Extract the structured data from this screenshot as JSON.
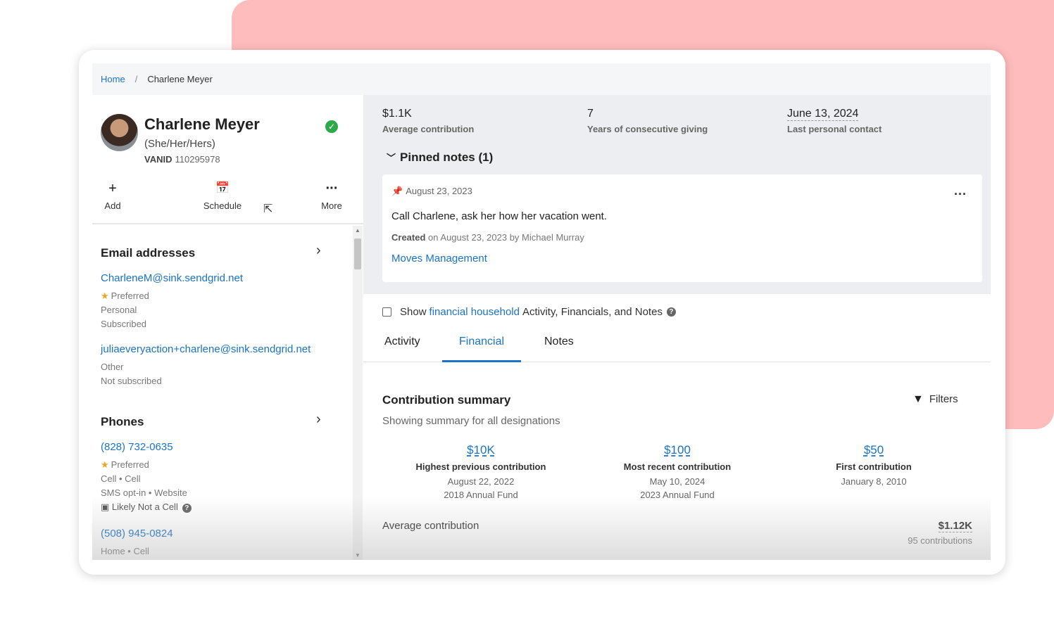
{
  "breadcrumb": {
    "home": "Home",
    "separator": "/",
    "current": "Charlene Meyer"
  },
  "profile": {
    "name": "Charlene Meyer",
    "pronouns": "(She/Her/Hers)",
    "vanid_label": "VANID",
    "vanid": "110295978",
    "verified_icon": "check-circle-icon"
  },
  "actions": [
    {
      "label": "Add",
      "icon": "+"
    },
    {
      "label": "Schedule",
      "icon": "📅"
    },
    {
      "label": "More",
      "icon": "···"
    }
  ],
  "emails": {
    "title": "Email addresses",
    "items": [
      {
        "address": "CharleneM@sink.sendgrid.net",
        "preferred": "Preferred",
        "type": "Personal",
        "status": "Subscribed"
      },
      {
        "address": "juliaeveryaction+charlene@sink.sendgrid.net",
        "type": "Other",
        "status": "Not subscribed"
      }
    ]
  },
  "phones": {
    "title": "Phones",
    "items": [
      {
        "number": "(828) 732-0635",
        "preferred": "Preferred",
        "type": "Cell • Cell",
        "opt": "SMS opt-in • Website",
        "warning": "Likely Not a Cell"
      },
      {
        "number": "(508) 945-0824",
        "type": "Home • Cell"
      }
    ]
  },
  "stats": [
    {
      "value": "$1.1K",
      "label": "Average contribution"
    },
    {
      "value": "7",
      "label": "Years of consecutive giving"
    },
    {
      "value": "June 13, 2024",
      "label": "Last personal contact"
    }
  ],
  "pinned": {
    "title": "Pinned notes (1)",
    "note": {
      "date": "August 23, 2023",
      "text": "Call Charlene, ask her how her vacation went.",
      "created_label": "Created",
      "created_rest": "on August 23, 2023 by Michael Murray",
      "tag": "Moves Management"
    }
  },
  "household": {
    "pre": "Show",
    "link": "financial household",
    "post": "Activity, Financials, and Notes"
  },
  "tabs": [
    {
      "label": "Activity",
      "active": false
    },
    {
      "label": "Financial",
      "active": true
    },
    {
      "label": "Notes",
      "active": false
    }
  ],
  "contribution": {
    "title": "Contribution summary",
    "subtitle": "Showing summary for all designations",
    "filters": "Filters",
    "columns": [
      {
        "value": "$10K",
        "label": "Highest previous contribution",
        "date": "August 22, 2022",
        "fund": "2018 Annual Fund"
      },
      {
        "value": "$100",
        "label": "Most recent contribution",
        "date": "May 10, 2024",
        "fund": "2023 Annual Fund"
      },
      {
        "value": "$50",
        "label": "First contribution",
        "date": "January 8, 2010",
        "fund": ""
      }
    ],
    "average_label": "Average contribution",
    "average_value": "$1.12K",
    "average_count": "95 contributions"
  },
  "colors": {
    "accent": "#1a73c7",
    "background_blob": "#ffbcbc",
    "verified": "#2ea84a",
    "star": "#f2a51a"
  }
}
